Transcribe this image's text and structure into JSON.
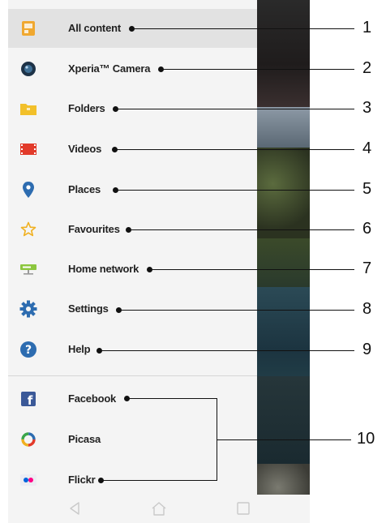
{
  "menu": {
    "items": [
      {
        "label": "All content",
        "icon": "all-content-icon",
        "number": "1"
      },
      {
        "label": "Xperia™ Camera",
        "icon": "camera-icon",
        "number": "2"
      },
      {
        "label": "Folders",
        "icon": "folder-icon",
        "number": "3"
      },
      {
        "label": "Videos",
        "icon": "film-icon",
        "number": "4"
      },
      {
        "label": "Places",
        "icon": "location-pin-icon",
        "number": "5"
      },
      {
        "label": "Favourites",
        "icon": "star-icon",
        "number": "6"
      },
      {
        "label": "Home network",
        "icon": "home-network-icon",
        "number": "7"
      },
      {
        "label": "Settings",
        "icon": "gear-icon",
        "number": "8"
      },
      {
        "label": "Help",
        "icon": "help-icon",
        "number": "9"
      }
    ],
    "services": [
      {
        "label": "Facebook",
        "icon": "facebook-icon"
      },
      {
        "label": "Picasa",
        "icon": "picasa-icon"
      },
      {
        "label": "Flickr",
        "icon": "flickr-icon"
      }
    ],
    "services_number": "10"
  },
  "navbar": {
    "buttons": [
      "back-icon",
      "home-icon",
      "recent-apps-icon"
    ]
  },
  "colors": {
    "drawer_bg": "#f4f4f4",
    "active_bg": "#e2e2e2",
    "accent_blue": "#2d6cb0",
    "accent_orange": "#f0a830",
    "facebook_blue": "#3b5998"
  }
}
